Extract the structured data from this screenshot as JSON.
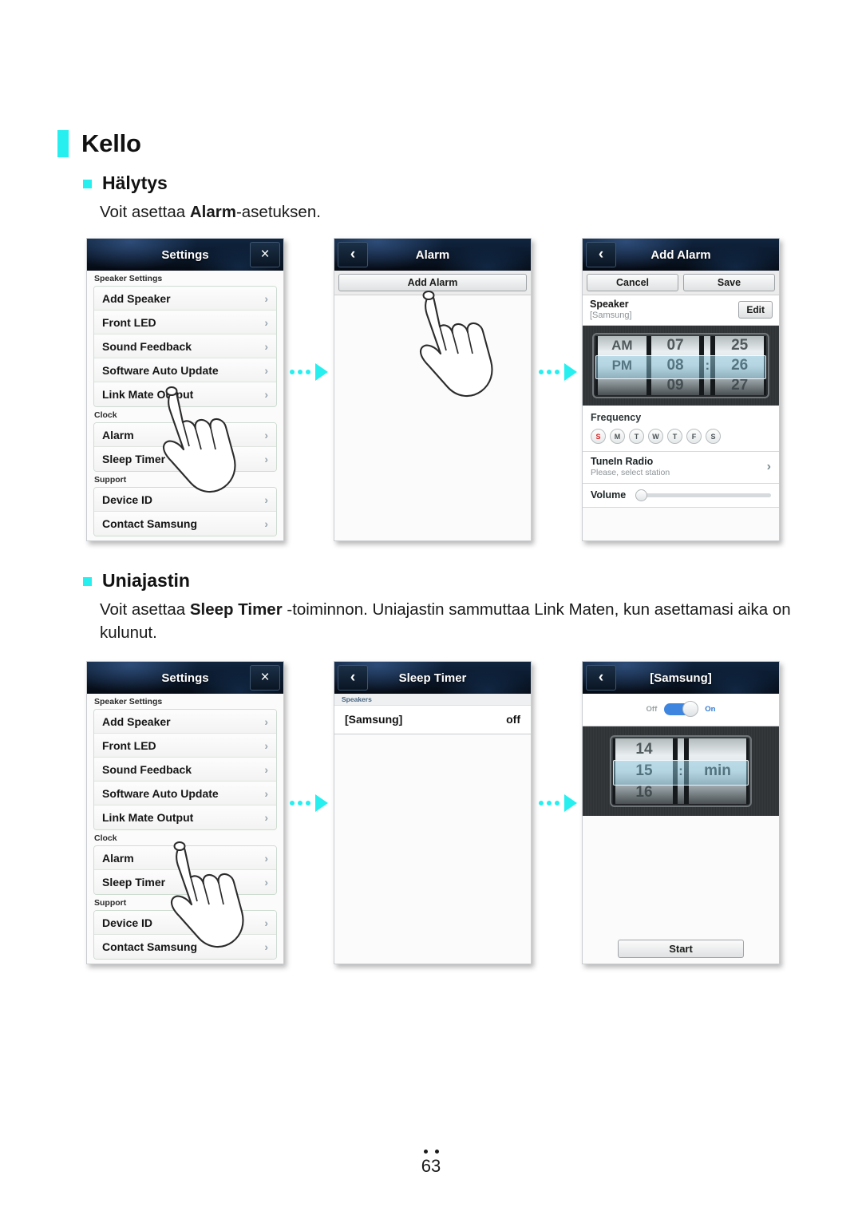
{
  "page": {
    "heading": "Kello",
    "number": "63"
  },
  "sections": [
    {
      "title": "Hälytys",
      "body_pre": "Voit asettaa ",
      "body_bold": "Alarm",
      "body_post": "-asetuksen."
    },
    {
      "title": "Uniajastin",
      "body_pre": "Voit asettaa ",
      "body_bold": "Sleep Timer",
      "body_post": " -toiminnon. Uniajastin sammuttaa Link Maten, kun asettamasi aika on kulunut."
    }
  ],
  "settings_screen": {
    "title": "Settings",
    "close_icon": "×",
    "groups": [
      {
        "label": "Speaker Settings",
        "items": [
          "Add Speaker",
          "Front LED",
          "Sound Feedback",
          "Software Auto Update",
          "Link Mate Output"
        ]
      },
      {
        "label": "Clock",
        "items": [
          "Alarm",
          "Sleep Timer"
        ]
      },
      {
        "label": "Support",
        "items": [
          "Device ID",
          "Contact Samsung"
        ]
      }
    ],
    "chevron": "›"
  },
  "alarm_screen": {
    "title": "Alarm",
    "back_icon": "‹",
    "add_button": "Add Alarm"
  },
  "add_alarm_screen": {
    "title": "Add Alarm",
    "back_icon": "‹",
    "cancel": "Cancel",
    "save": "Save",
    "speaker_label": "Speaker",
    "speaker_value": "[Samsung]",
    "edit": "Edit",
    "picker": {
      "meridiem": {
        "above": "AM",
        "selected": "PM",
        "below": ""
      },
      "hour": {
        "above": "07",
        "selected": "08",
        "below": "09"
      },
      "separator": ":",
      "minute": {
        "above": "25",
        "selected": "26",
        "below": "27"
      }
    },
    "frequency_label": "Frequency",
    "days": [
      {
        "letter": "S",
        "highlight": true
      },
      {
        "letter": "M",
        "highlight": false
      },
      {
        "letter": "T",
        "highlight": false
      },
      {
        "letter": "W",
        "highlight": false
      },
      {
        "letter": "T",
        "highlight": false
      },
      {
        "letter": "F",
        "highlight": false
      },
      {
        "letter": "S",
        "highlight": false
      }
    ],
    "tunein_title": "TuneIn Radio",
    "tunein_sub": "Please, select station",
    "tunein_chevron": "›",
    "volume_label": "Volume"
  },
  "sleep_timer_screen": {
    "title": "Sleep Timer",
    "back_icon": "‹",
    "group_label": "Speakers",
    "speaker_name": "[Samsung]",
    "speaker_state": "off"
  },
  "samsung_timer_screen": {
    "title": "[Samsung]",
    "back_icon": "‹",
    "toggle_off": "Off",
    "toggle_on": "On",
    "picker": {
      "above": "14",
      "selected": "15",
      "below": "16",
      "separator": ":",
      "unit": "min"
    },
    "start": "Start"
  },
  "colors": {
    "accent": "#27eff0",
    "titlebar_dark": "#0b1a2e",
    "toggle_blue": "#3d85df",
    "day_red": "#e02020"
  }
}
